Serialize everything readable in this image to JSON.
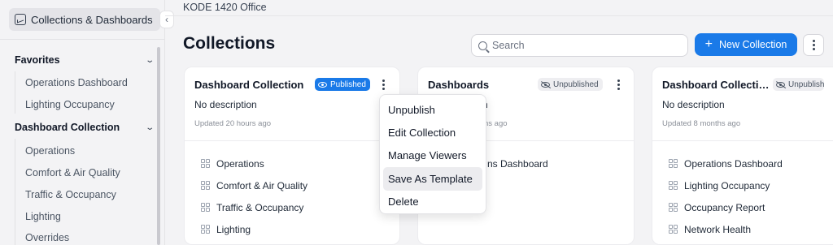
{
  "sidebar": {
    "top_label": "Collections & Dashboards",
    "groups": [
      {
        "label": "Favorites",
        "items": [
          "Operations Dashboard",
          "Lighting Occupancy"
        ]
      },
      {
        "label": "Dashboard Collection",
        "items": [
          "Operations",
          "Comfort & Air Quality",
          "Traffic & Occupancy",
          "Lighting",
          "Overrides"
        ]
      }
    ]
  },
  "header": {
    "breadcrumb": "KODE 1420 Office",
    "title": "Collections",
    "search_placeholder": "Search",
    "new_button": "New Collection"
  },
  "cards": [
    {
      "title": "Dashboard Collection",
      "status": "Published",
      "description": "No description",
      "updated": "Updated 20 hours ago",
      "dashboards": [
        "Operations",
        "Comfort & Air Quality",
        "Traffic & Occupancy",
        "Lighting"
      ]
    },
    {
      "title": "Dashboards",
      "status": "Unpublished",
      "description_partial": "n",
      "updated_partial": "hs ago",
      "dashboards_partial": [
        "ns Dashboard"
      ]
    },
    {
      "title": "Dashboard Collecti…",
      "status": "Unpublish",
      "description": "No description",
      "updated": "Updated 8 months ago",
      "dashboards": [
        "Operations Dashboard",
        "Lighting Occupancy",
        "Occupancy Report",
        "Network Health"
      ]
    }
  ],
  "menu": {
    "items": [
      "Unpublish",
      "Edit Collection",
      "Manage Viewers",
      "Save As Template",
      "Delete"
    ],
    "highlighted": "Save As Template"
  },
  "colors": {
    "accent": "#1a7ae8",
    "background": "#f3f3f5"
  }
}
